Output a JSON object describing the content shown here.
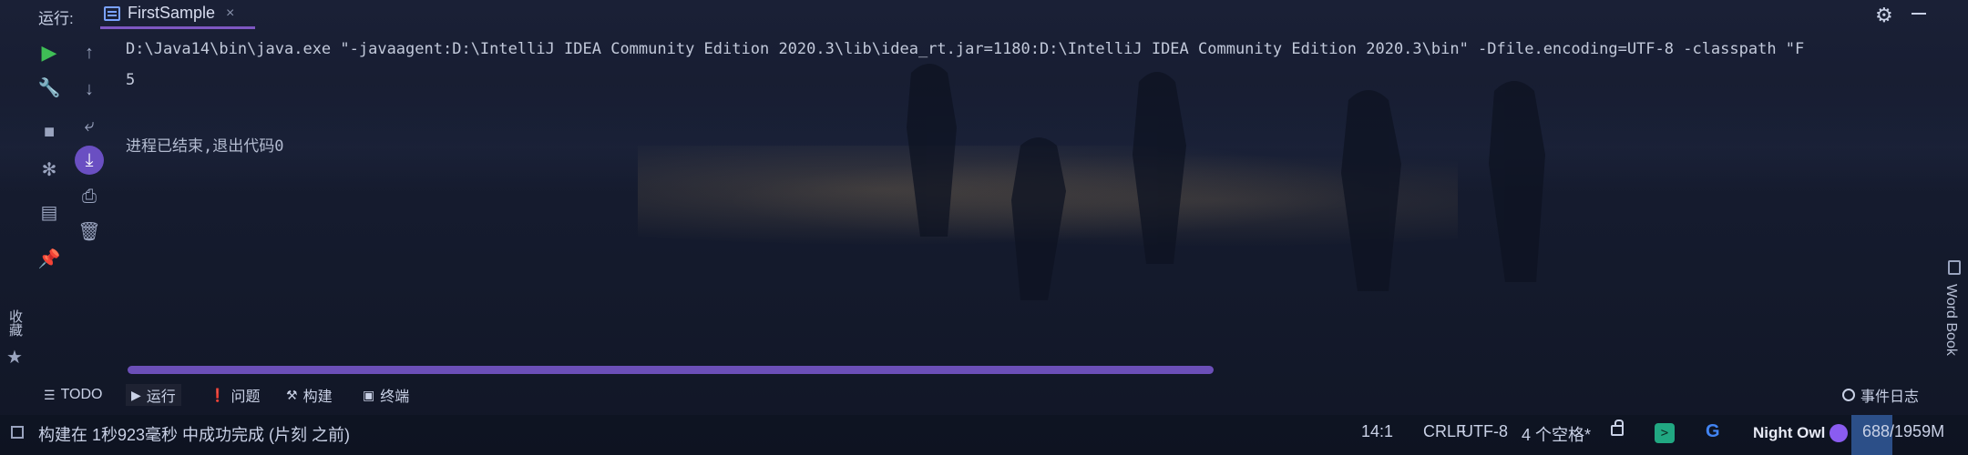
{
  "header": {
    "run_label": "运行:",
    "tab_title": "FirstSample",
    "tab_close": "×"
  },
  "console": {
    "command_line": "D:\\Java14\\bin\\java.exe \"-javaagent:D:\\IntelliJ IDEA Community Edition 2020.3\\lib\\idea_rt.jar=1180:D:\\IntelliJ IDEA Community Edition 2020.3\\bin\" -Dfile.encoding=UTF-8 -classpath \"F",
    "output": "5",
    "exit_message": "进程已结束,退出代码0"
  },
  "left_toolbar": {
    "col1": [
      "run-icon",
      "wrench-icon",
      "stop-icon",
      "bug-settings-icon",
      "layout-icon",
      "pin-icon"
    ],
    "col2": [
      "arrow-up-icon",
      "arrow-down-icon",
      "soft-wrap-icon",
      "scroll-to-end-icon",
      "print-icon",
      "trash-icon"
    ]
  },
  "favorites": {
    "label": "收藏"
  },
  "word_book": {
    "label": "Word Book"
  },
  "tool_windows": {
    "todo": "TODO",
    "run": "运行",
    "problems": "问题",
    "build": "构建",
    "terminal": "终端",
    "event_log": "事件日志"
  },
  "status_bar": {
    "message": "构建在 1秒923毫秒 中成功完成 (片刻 之前)",
    "position": "14:1",
    "line_separator": "CRLF",
    "encoding": "UTF-8",
    "indent": "4 个空格*",
    "theme": "Night Owl",
    "memory": "688/1959M",
    "memory_used_fraction": 0.351
  },
  "colors": {
    "accent": "#7e57c2",
    "run_green": "#3fbf56"
  }
}
